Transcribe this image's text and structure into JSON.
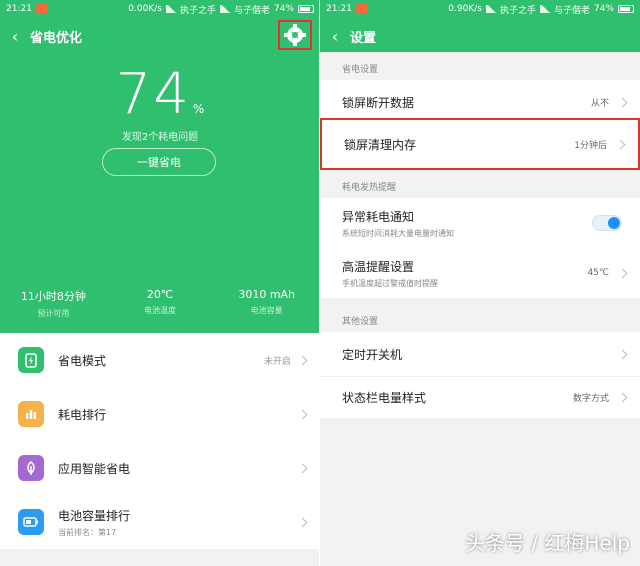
{
  "left": {
    "status": {
      "time": "21:21",
      "speed": "0.00K/s",
      "carrier1": "执子之手",
      "carrier2": "与子偕老",
      "battery": "74%"
    },
    "header": {
      "title": "省电优化"
    },
    "battery": {
      "percent": "74",
      "percent_symbol": "%"
    },
    "issue_text": {
      "pre": "发现",
      "count": "2",
      "post": "个耗电问题"
    },
    "save_button": "一键省电",
    "stats": [
      {
        "value": "11小时8分钟",
        "label": "预计可用"
      },
      {
        "value": "20℃",
        "label": "电池温度"
      },
      {
        "value": "3010 mAh",
        "label": "电池容量"
      }
    ],
    "list": [
      {
        "title": "省电模式",
        "value": "未开启",
        "sub": "",
        "icon": "power-saver-icon",
        "color": "#2fbf6e"
      },
      {
        "title": "耗电排行",
        "value": "",
        "sub": "",
        "icon": "bar-chart-icon",
        "color": "#f5b14a"
      },
      {
        "title": "应用智能省电",
        "value": "",
        "sub": "",
        "icon": "leaf-icon",
        "color": "#a56ad2"
      },
      {
        "title": "电池容量排行",
        "value": "",
        "sub": "当前排名：第17",
        "icon": "battery-icon",
        "color": "#2d9bf0"
      }
    ]
  },
  "right": {
    "status": {
      "time": "21:21",
      "speed": "0.90K/s",
      "carrier1": "执子之手",
      "carrier2": "与子偕老",
      "battery": "74%"
    },
    "header": {
      "title": "设置"
    },
    "sections": [
      {
        "label": "省电设置"
      },
      {
        "label": "耗电发热提醒"
      },
      {
        "label": "其他设置"
      }
    ],
    "items": [
      {
        "title": "锁屏断开数据",
        "value": "从不",
        "sub": ""
      },
      {
        "title": "锁屏清理内存",
        "value": "1分钟后",
        "sub": ""
      },
      {
        "title": "异常耗电通知",
        "value": "",
        "sub": "系统短时间消耗大量电量时通知"
      },
      {
        "title": "高温提醒设置",
        "value": "45℃",
        "sub": "手机温度超过警戒值时提醒"
      },
      {
        "title": "定时开关机",
        "value": "",
        "sub": ""
      },
      {
        "title": "状态栏电量样式",
        "value": "数字方式",
        "sub": ""
      }
    ]
  },
  "watermark": "头条号 / 红梅Help",
  "colors": {
    "primary_green": "#2fbf6e",
    "highlight_red": "#e0322f",
    "toggle_blue": "#1e90ff"
  }
}
